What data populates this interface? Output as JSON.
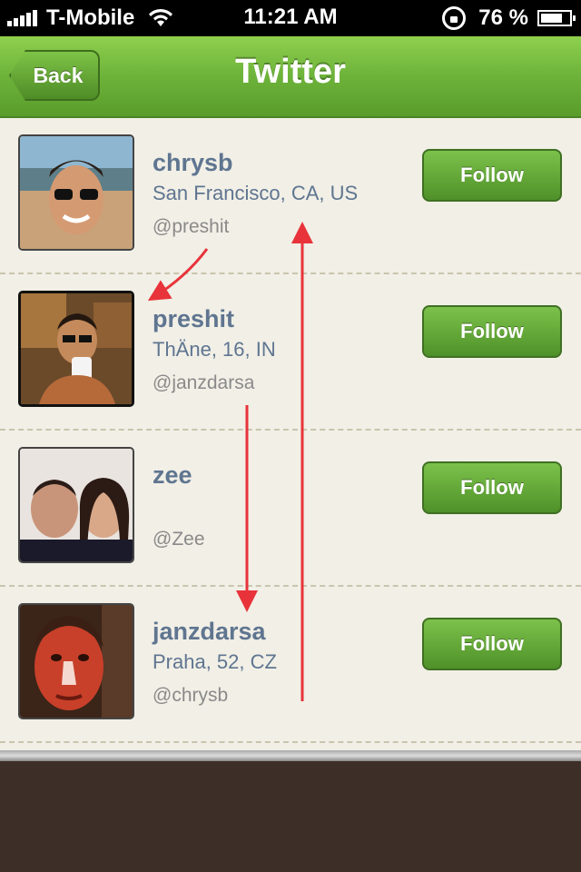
{
  "status_bar": {
    "carrier": "T-Mobile",
    "time": "11:21 AM",
    "battery": "76 %",
    "battery_level": 0.76
  },
  "nav": {
    "back_label": "Back",
    "title": "Twitter"
  },
  "users": [
    {
      "name": "chrysb",
      "location": "San Francisco, CA, US",
      "handle": "@preshit",
      "follow_label": "Follow"
    },
    {
      "name": "preshit",
      "location": "ThÄne, 16, IN",
      "handle": "@janzdarsa",
      "follow_label": "Follow"
    },
    {
      "name": "zee",
      "location": "",
      "handle": "@Zee",
      "follow_label": "Follow"
    },
    {
      "name": "janzdarsa",
      "location": "Praha, 52, CZ",
      "handle": "@chrysb",
      "follow_label": "Follow"
    }
  ],
  "colors": {
    "nav_green": "#6db33a",
    "follow_green": "#5fa733",
    "name_blue": "#5f7590",
    "arrow_red": "#e8333a"
  }
}
